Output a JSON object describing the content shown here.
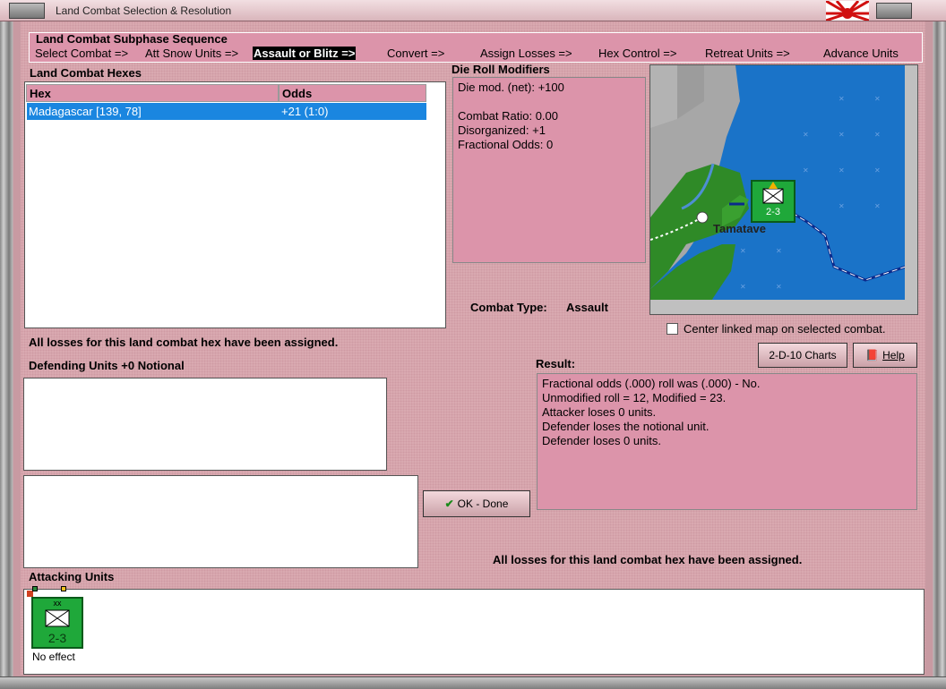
{
  "window": {
    "title": "Land Combat Selection & Resolution"
  },
  "sequence": {
    "heading": "Land Combat Subphase Sequence",
    "steps": [
      "Select Combat =>",
      "Att Snow Units =>",
      "Assault or Blitz =>",
      "Convert =>",
      "Assign Losses =>",
      "Hex Control =>",
      "Retreat Units =>",
      "Advance Units"
    ],
    "active_index": 2
  },
  "hexes": {
    "heading": "Land Combat Hexes",
    "columns": [
      "Hex",
      "Odds"
    ],
    "rows": [
      {
        "hex": "Madagascar [139, 78]",
        "odds": "+21 (1:0)"
      }
    ]
  },
  "modifiers": {
    "heading": "Die Roll Modifiers",
    "lines": [
      "Die mod. (net): +100",
      "",
      "Combat Ratio: 0.00",
      "Disorganized: +1",
      "Fractional Odds: 0"
    ]
  },
  "combat_type": {
    "label": "Combat Type:",
    "value": "Assault"
  },
  "map": {
    "place_name": "Tamatave",
    "unit_strength": "2-3",
    "center_label": "Center linked map on selected combat."
  },
  "status_top": "All losses for this land combat hex have been assigned.",
  "defending": {
    "heading": "Defending Units +0 Notional"
  },
  "buttons": {
    "charts": "2-D-10 Charts",
    "help": "Help",
    "ok": "OK - Done"
  },
  "result": {
    "heading": "Result:",
    "lines": [
      "Fractional odds (.000) roll was (.000)  - No.",
      "Unmodified roll = 12, Modified = 23.",
      "Attacker loses 0 units.",
      "Defender loses the notional unit.",
      "Defender loses 0 units."
    ]
  },
  "status_bottom": "All losses for this land combat hex have been assigned.",
  "attacking": {
    "heading": "Attacking Units",
    "units": [
      {
        "size": "xx",
        "strength": "2-3",
        "result": "No effect"
      }
    ]
  },
  "colors": {
    "panel_pink": "#dc94aa",
    "selection_blue": "#1a86e0",
    "unit_green": "#1fa83a",
    "sea_blue": "#1a73c8"
  }
}
